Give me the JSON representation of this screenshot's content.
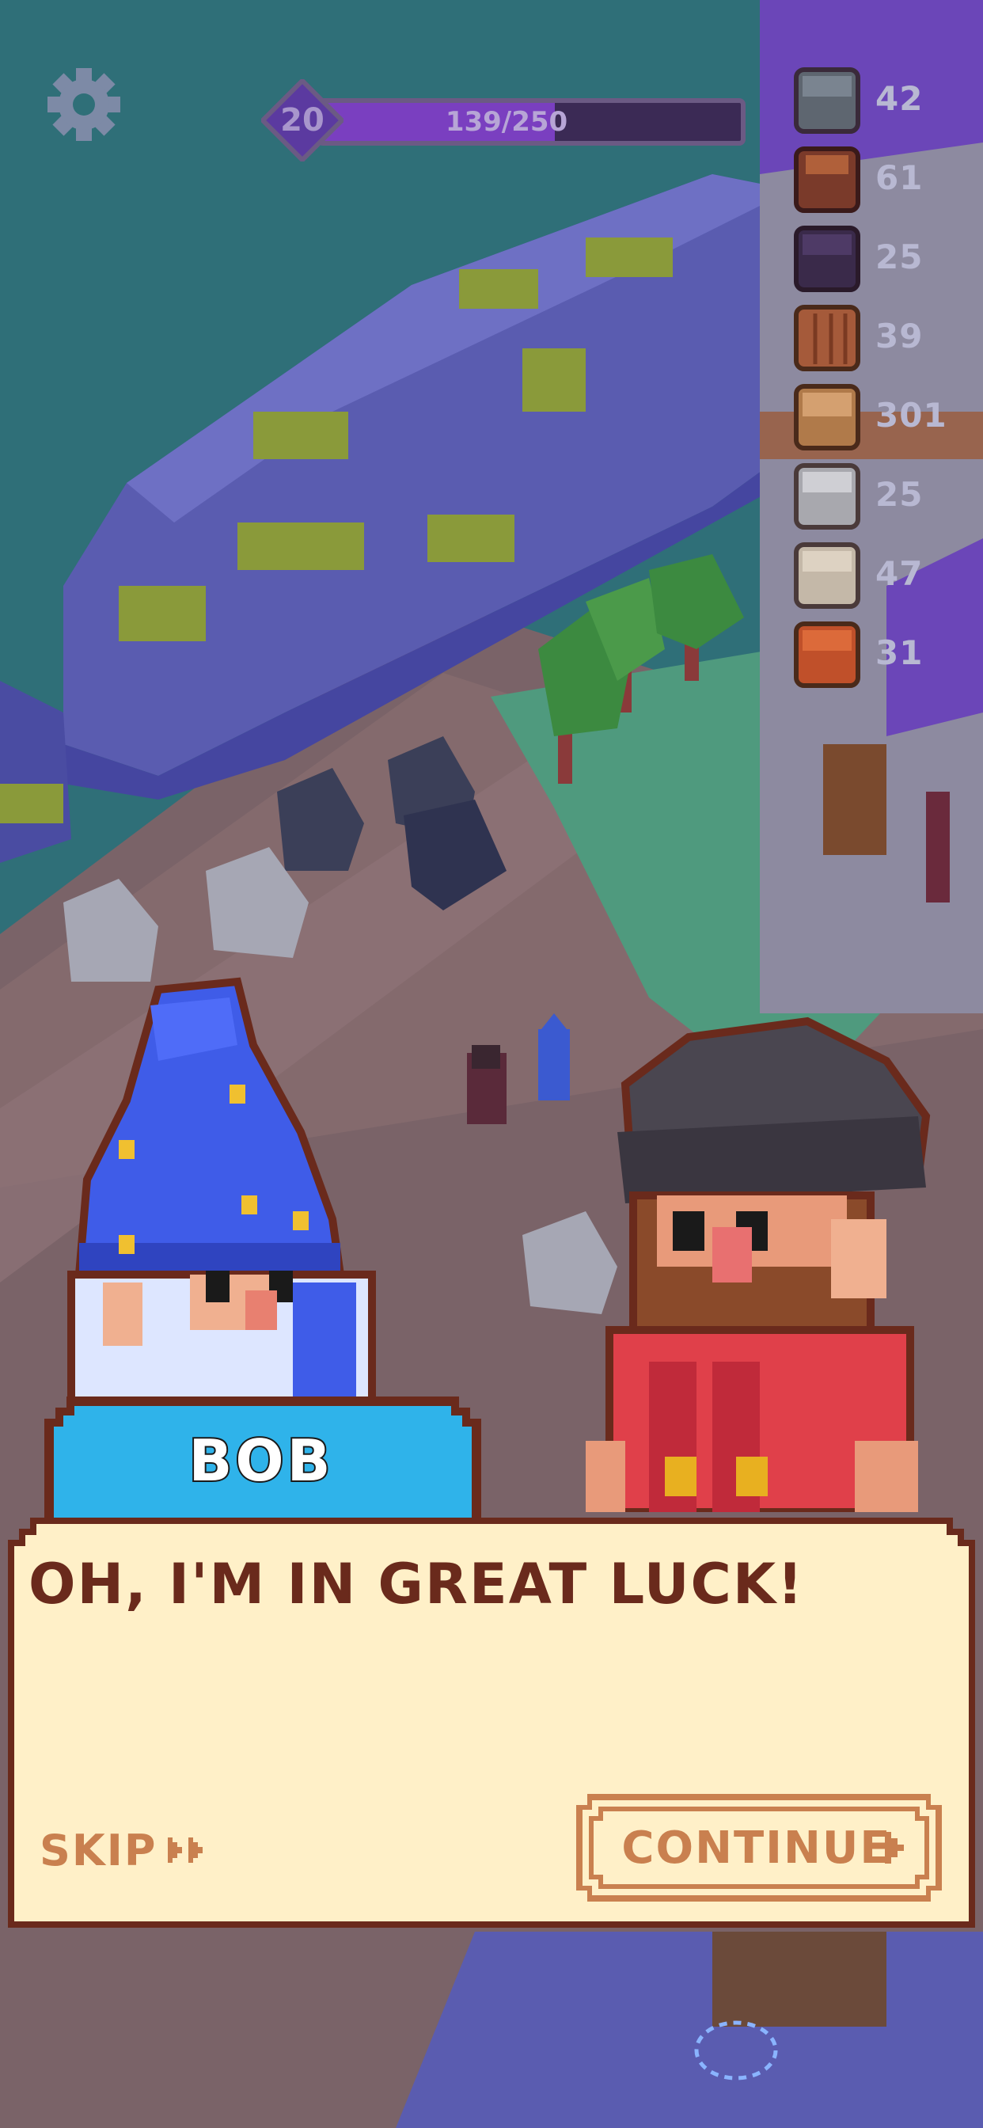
{
  "hud": {
    "settings_icon": "gear-icon",
    "level": "20",
    "xp_text": "139/250",
    "xp_fraction": 0.556,
    "resources": [
      {
        "icon": "stone-block-icon",
        "count": "42"
      },
      {
        "icon": "wood-log-icon",
        "count": "61"
      },
      {
        "icon": "dark-crystal-block-icon",
        "count": "25"
      },
      {
        "icon": "wood-plank-block-icon",
        "count": "39"
      },
      {
        "icon": "bread-icon",
        "count": "301"
      },
      {
        "icon": "silver-block-icon",
        "count": "25"
      },
      {
        "icon": "sandstone-block-icon",
        "count": "47"
      },
      {
        "icon": "brick-block-icon",
        "count": "31"
      }
    ]
  },
  "dialog": {
    "speaker": "BOB",
    "text": "OH, I'M IN GREAT LUCK!",
    "skip_label": "SKIP",
    "continue_label": "CONTINUE"
  },
  "colors": {
    "water": "#2f6f78",
    "cliff": "#5a5cb0",
    "ground": "#7a6368",
    "nameplate": "#2fb3ea",
    "dialog_bg": "#fff0c8",
    "dialog_border": "#6a2a1c",
    "button_text": "#c9804f"
  }
}
